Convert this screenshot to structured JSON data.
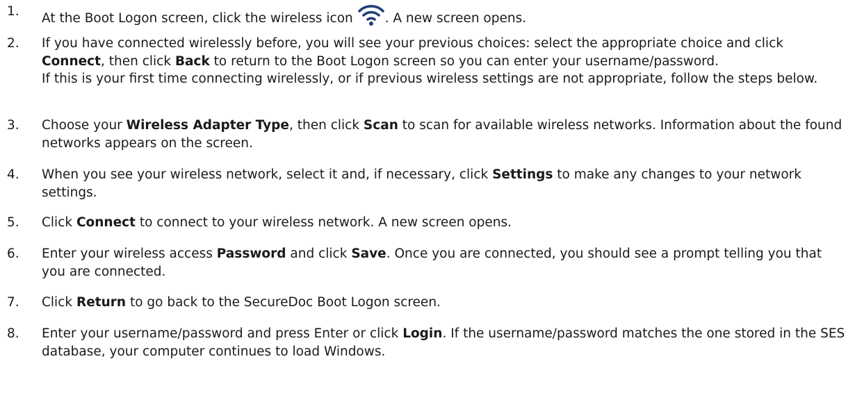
{
  "colors": {
    "text": "#1a1a1a",
    "icon": "#1e3f75"
  },
  "steps": [
    {
      "num": "1.",
      "lines": [
        [
          {
            "t": "At the Boot Logon screen, click the wireless icon "
          },
          {
            "icon": "wifi-icon"
          },
          {
            "t": ". A new screen opens."
          }
        ]
      ]
    },
    {
      "num": "2.",
      "lines": [
        [
          {
            "t": "If you have connected wirelessly before, you will see your previous choices: select the appropriate choice and click "
          },
          {
            "b": "Connect"
          },
          {
            "t": ", then click "
          },
          {
            "b": "Back"
          },
          {
            "t": " to return to the Boot Logon screen so you can enter your username/password."
          }
        ],
        [
          {
            "t": "If this is your first time connecting wirelessly, or if previous wireless settings are not appropriate, follow the steps below."
          }
        ]
      ]
    },
    {
      "num": "3.",
      "lines": [
        [
          {
            "t": "Choose your "
          },
          {
            "b": "Wireless Adapter Type"
          },
          {
            "t": ", then click "
          },
          {
            "b": "Scan"
          },
          {
            "t": " to scan for available wireless networks. Information about the found networks appears on the screen."
          }
        ]
      ]
    },
    {
      "num": "4.",
      "lines": [
        [
          {
            "t": "When you see your wireless network, select it and, if necessary, click "
          },
          {
            "b": "Settings"
          },
          {
            "t": " to make any changes to your network settings."
          }
        ]
      ]
    },
    {
      "num": "5.",
      "lines": [
        [
          {
            "t": "Click "
          },
          {
            "b": "Connect"
          },
          {
            "t": " to connect to your wireless network. A new screen opens."
          }
        ]
      ]
    },
    {
      "num": "6.",
      "lines": [
        [
          {
            "t": "Enter your wireless access "
          },
          {
            "b": "Password"
          },
          {
            "t": " and click "
          },
          {
            "b": "Save"
          },
          {
            "t": ". Once you are connected, you should see a prompt telling you that you are connected."
          }
        ]
      ]
    },
    {
      "num": "7.",
      "lines": [
        [
          {
            "t": "Click "
          },
          {
            "b": "Return"
          },
          {
            "t": " to go back to the SecureDoc Boot Logon screen."
          }
        ]
      ]
    },
    {
      "num": "8.",
      "lines": [
        [
          {
            "t": "Enter your username/password and press Enter or click "
          },
          {
            "b": "Login"
          },
          {
            "t": ". If the username/password matches the one stored in the SES database, your computer continues to load Windows."
          }
        ]
      ]
    }
  ]
}
